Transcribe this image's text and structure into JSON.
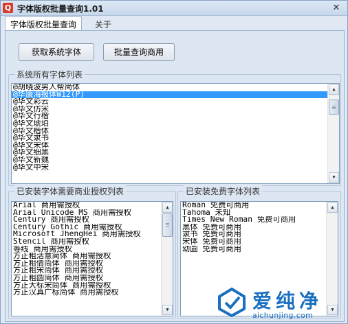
{
  "window": {
    "title": "字体版权批量查询1.01",
    "app_icon": "magnifier-icon",
    "close_glyph": "✕"
  },
  "tabs": [
    {
      "label": "字体版权批量查询",
      "active": true
    },
    {
      "label": "关于",
      "active": false
    }
  ],
  "buttons": {
    "get_fonts": "获取系统字体",
    "batch_query": "批量查询商用"
  },
  "system_fonts": {
    "title": "系统所有字体列表",
    "items": [
      "@胡晓波男人帮简体",
      "@华康海报体W12(P)",
      "@华文彩云",
      "@华文仿宋",
      "@华文行楷",
      "@华文琥珀",
      "@华文楷体",
      "@华文隶书",
      "@华文宋体",
      "@华文细黑",
      "@华文新魏",
      "@华文中宋"
    ],
    "selected_index": 1
  },
  "licensed_fonts": {
    "title": "已安装字体需要商业授权列表",
    "items": [
      "Arial 商用需授权",
      "Arial Unicode MS 商用需授权",
      "Century 商用需授权",
      "Century Gothic 商用需授权",
      "Microsoft JhengHei 商用需授权",
      "Stencil 商用需授权",
      "等线 商用需授权",
      "方正粗活意简体 商用需授权",
      "方正粗倩简体 商用需授权",
      "方正粗宋简体 商用需授权",
      "方正粗圆简体 商用需授权",
      "方正大标宋简体 商用需授权",
      "方正汉真广标简体 商用需授权"
    ]
  },
  "free_fonts": {
    "title": "已安装免费字体列表",
    "items": [
      "Roman 免费可商用",
      "Tahoma 未知",
      "Times New Roman 免费可商用",
      "黑体 免费可商用",
      "隶书 免费可商用",
      "宋体 免费可商用",
      "幼圆 免费可商用"
    ]
  },
  "watermark": {
    "brand": "爱纯净",
    "url": "aichunjing.com",
    "color": "#1a6fc0"
  },
  "colors": {
    "selection": "#3399ff",
    "window_bg": "#dfe8f3"
  }
}
